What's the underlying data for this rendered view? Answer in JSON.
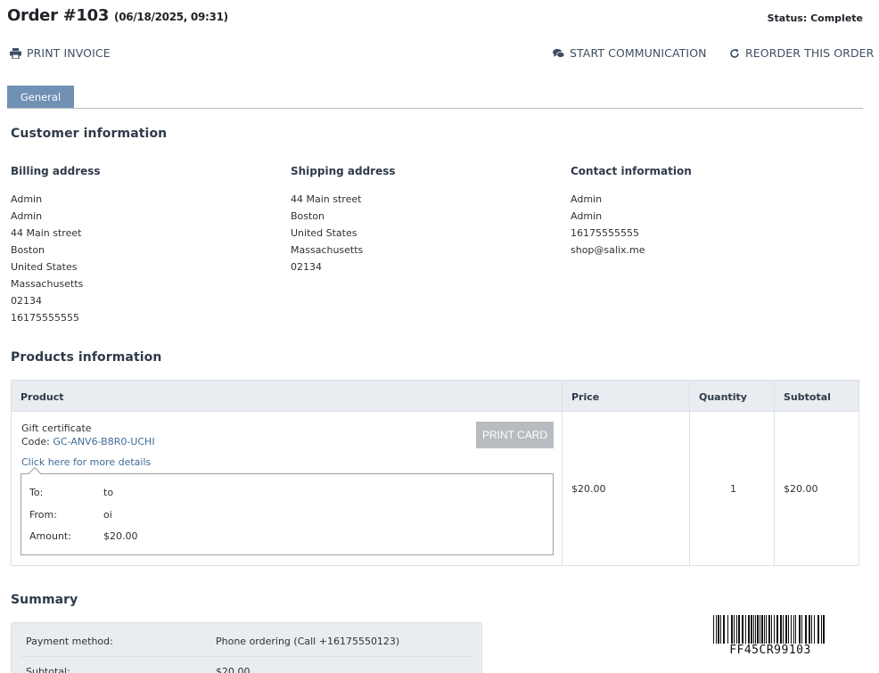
{
  "header": {
    "order_title": "Order #103",
    "order_date": "(06/18/2025, 09:31)",
    "status": "Status: Complete"
  },
  "actions": {
    "print_invoice": "PRINT INVOICE",
    "start_communication": "START COMMUNICATION",
    "reorder": "REORDER THIS ORDER"
  },
  "tabs": [
    {
      "label": "General",
      "active": true
    }
  ],
  "customer": {
    "section_title": "Customer information",
    "billing": {
      "title": "Billing address",
      "lines": [
        "Admin",
        "Admin",
        "44 Main street",
        "Boston",
        "United States",
        "Massachusetts",
        "02134",
        "16175555555"
      ]
    },
    "shipping": {
      "title": "Shipping address",
      "lines": [
        "44 Main street",
        "Boston",
        "United States",
        "Massachusetts",
        "02134"
      ]
    },
    "contact": {
      "title": "Contact information",
      "lines": [
        "Admin",
        "Admin",
        "16175555555",
        "shop@salix.me"
      ]
    }
  },
  "products": {
    "section_title": "Products information",
    "columns": [
      "Product",
      "Price",
      "Quantity",
      "Subtotal"
    ],
    "rows": [
      {
        "name": "Gift certificate",
        "code_label": "Code:",
        "code": "GC-ANV6-B8R0-UCHI",
        "print_card": "PRINT CARD",
        "details_link": "Click here for more details",
        "details": [
          {
            "label": "To:",
            "value": "to"
          },
          {
            "label": "From:",
            "value": "oi"
          },
          {
            "label": "Amount:",
            "value": "$20.00"
          }
        ],
        "price": "$20.00",
        "quantity": "1",
        "subtotal": "$20.00"
      }
    ]
  },
  "summary": {
    "section_title": "Summary",
    "rows": [
      {
        "label": "Payment method:",
        "value": "Phone ordering (Call +16175550123)"
      },
      {
        "label": "Subtotal:",
        "value": "$20.00"
      }
    ]
  },
  "barcode": {
    "text": "FF45CR99103"
  },
  "colors": {
    "tab_active": "#7090b4",
    "link": "#3f6b99",
    "print_card_disabled": "#b8bcc1",
    "table_header": "#e9ecf0"
  }
}
